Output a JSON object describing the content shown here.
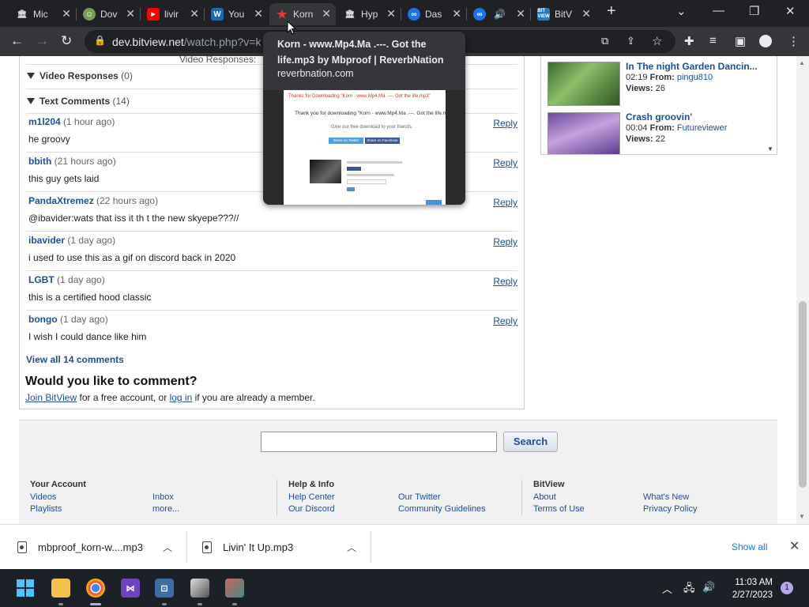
{
  "browser": {
    "tabs": [
      {
        "label": "Mic",
        "icon": "library-icon"
      },
      {
        "label": "Dov",
        "icon": "avatar-icon"
      },
      {
        "label": "livir",
        "icon": "youtube-icon"
      },
      {
        "label": "You",
        "icon": "w-icon"
      },
      {
        "label": "Korn",
        "icon": "star-icon"
      },
      {
        "label": "Hyp",
        "icon": "library-icon"
      },
      {
        "label": "Das",
        "icon": "loop-icon"
      },
      {
        "label": "",
        "icon": "loop-icon"
      },
      {
        "label": "BitV",
        "icon": "bitview-icon"
      }
    ],
    "url_host": "dev.bitview.net",
    "url_path": "/watch.php?v=k"
  },
  "tooltip": {
    "title": "Korn - www.Mp4.Ma .---. Got the life.mp3 by Mbproof | ReverbNation",
    "domain": "reverbnation.com",
    "preview_heading": "Thanks for Downloading \"Korn - www.Mp4.Ma .---. Got the life.mp3\"",
    "preview_text": "Thank you for downloading \"Korn - www.Mp4.Ma .---. Got the life.mp3.\"",
    "preview_sub": "Give our free download to your friends.",
    "preview_btn1": "Share on Twitter",
    "preview_btn2": "Share on Facebook"
  },
  "comments_section": {
    "partial_label": "Video Responses:",
    "video_responses_label": "Video Responses",
    "video_responses_count": "(0)",
    "text_comments_label": "Text Comments",
    "text_comments_count": "(14)",
    "reply_label": "Reply",
    "items": [
      {
        "user": "m1l204",
        "time": "(1 hour ago)",
        "text": "he groovy"
      },
      {
        "user": "bbith",
        "time": "(21 hours ago)",
        "text": "this guy gets laid"
      },
      {
        "user": "PandaXtremez",
        "time": "(22 hours ago)",
        "text": "@ibavider:wats that iss it th t the new skyepe???//"
      },
      {
        "user": "ibavider",
        "time": "(1 day ago)",
        "text": "i used to use this as a gif on discord back in 2020"
      },
      {
        "user": "LGBT",
        "time": "(1 day ago)",
        "text": "this is a certified hood classic"
      },
      {
        "user": "bongo",
        "time": "(1 day ago)",
        "text": "I wish I could dance like him"
      }
    ],
    "view_all": "View all 14 comments",
    "cta_heading": "Would you like to comment?",
    "join_link": "Join BitView",
    "join_mid": " for a free account, or ",
    "login_link": "log in",
    "join_end": " if you are already a member."
  },
  "related": {
    "from_label": "From:",
    "views_label": "Views:",
    "items": [
      {
        "title": "In The night Garden Dancin...",
        "duration": "02:19",
        "user": "pingu810",
        "views": "26"
      },
      {
        "title": "Crash groovin'",
        "duration": "00:04",
        "user": "Futureviewer",
        "views": "22"
      }
    ]
  },
  "footer": {
    "search_button": "Search",
    "columns": [
      {
        "heading": "Your Account",
        "links": [
          "Videos",
          "Playlists",
          "Inbox",
          "more..."
        ]
      },
      {
        "heading": "Help & Info",
        "links": [
          "Help Center",
          "Our Discord",
          "Our Twitter",
          "Community Guidelines"
        ]
      },
      {
        "heading": "BitView",
        "links": [
          "About",
          "Terms of Use",
          "What's New",
          "Privacy Policy"
        ]
      }
    ]
  },
  "downloads": {
    "items": [
      {
        "name": "mbproof_korn-w....mp3"
      },
      {
        "name": "Livin' It Up.mp3"
      }
    ],
    "show_all": "Show all"
  },
  "taskbar": {
    "time": "11:03 AM",
    "date": "2/27/2023",
    "notifications": "1"
  }
}
